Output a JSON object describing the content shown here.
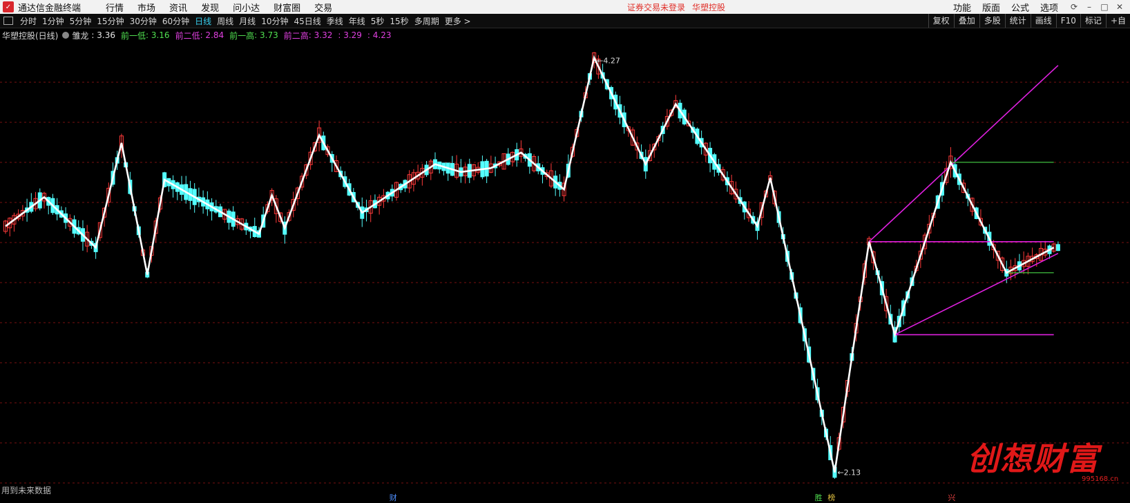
{
  "app": {
    "title": "通达信金融终端",
    "menu": [
      "行情",
      "市场",
      "资讯",
      "发现",
      "问小达",
      "财富圈",
      "交易"
    ],
    "notice": "证券交易未登录",
    "notice_stock": "华塑控股",
    "right_menu": [
      "功能",
      "版面",
      "公式",
      "选项"
    ]
  },
  "toolbar": {
    "periods": [
      "分时",
      "1分钟",
      "5分钟",
      "15分钟",
      "30分钟",
      "60分钟",
      "日线",
      "周线",
      "月线",
      "10分钟",
      "45日线",
      "季线",
      "年线",
      "5秒",
      "15秒",
      "多周期",
      "更多 >"
    ],
    "active_period": "日线",
    "tools": [
      "复权",
      "叠加",
      "多股",
      "统计",
      "画线",
      "F10",
      "标记",
      "+自"
    ]
  },
  "info": {
    "stock": "华塑控股(日线)",
    "indicator": "雏龙",
    "value": ": 3.36",
    "prev_low1_label": "前一低",
    "prev_low1": ": 3.16",
    "prev_low2_label": "前二低",
    "prev_low2": ": 2.84",
    "prev_high1_label": "前一高",
    "prev_high1": ": 3.73",
    "prev_high2_label": "前二高",
    "prev_high2": ": 3.32",
    "extra1": ": 3.29",
    "extra2": ": 4.23"
  },
  "chart_data": {
    "type": "candlestick",
    "title": "",
    "ylim": [
      2.05,
      4.35
    ],
    "annotations": {
      "high": "4.27",
      "low": "2.13"
    },
    "colors": {
      "up": "#ff3a3a",
      "down": "#54ffff",
      "zigzag": "#ffffff",
      "channel": "#e020e0",
      "level": "#40c040",
      "grid": "#7a1010"
    },
    "zigzag": [
      {
        "i": 0,
        "y": 3.4
      },
      {
        "i": 9,
        "y": 3.55
      },
      {
        "i": 21,
        "y": 3.29
      },
      {
        "i": 27,
        "y": 3.83
      },
      {
        "i": 33,
        "y": 3.15
      },
      {
        "i": 37,
        "y": 3.64
      },
      {
        "i": 59,
        "y": 3.36
      },
      {
        "i": 62,
        "y": 3.56
      },
      {
        "i": 65,
        "y": 3.39
      },
      {
        "i": 73,
        "y": 3.87
      },
      {
        "i": 83,
        "y": 3.47
      },
      {
        "i": 100,
        "y": 3.72
      },
      {
        "i": 106,
        "y": 3.68
      },
      {
        "i": 113,
        "y": 3.7
      },
      {
        "i": 120,
        "y": 3.78
      },
      {
        "i": 130,
        "y": 3.59
      },
      {
        "i": 137,
        "y": 4.27
      },
      {
        "i": 149,
        "y": 3.72
      },
      {
        "i": 156,
        "y": 4.03
      },
      {
        "i": 175,
        "y": 3.4
      },
      {
        "i": 178,
        "y": 3.65
      },
      {
        "i": 193,
        "y": 2.13
      },
      {
        "i": 201,
        "y": 3.32
      },
      {
        "i": 207,
        "y": 2.84
      },
      {
        "i": 220,
        "y": 3.73
      },
      {
        "i": 233,
        "y": 3.16
      },
      {
        "i": 244,
        "y": 3.29
      }
    ],
    "channel_lines": [
      {
        "from": {
          "i": 201,
          "y": 3.32
        },
        "to": {
          "i": 245,
          "y": 4.23
        }
      },
      {
        "from": {
          "i": 207,
          "y": 2.84
        },
        "to": {
          "i": 245,
          "y": 3.26
        }
      },
      {
        "from": {
          "i": 201,
          "y": 3.32
        },
        "to": {
          "i": 244,
          "y": 3.32
        }
      },
      {
        "from": {
          "i": 207,
          "y": 2.84
        },
        "to": {
          "i": 244,
          "y": 2.84
        }
      }
    ],
    "level_lines": [
      {
        "from_i": 220,
        "to_i": 244,
        "y": 3.73
      },
      {
        "from_i": 233,
        "to_i": 244,
        "y": 3.16
      }
    ],
    "candle_count": 246
  },
  "footer": {
    "note": "用到未来数据",
    "markers": [
      {
        "text": "财",
        "color": "#5090ff",
        "i": 90
      },
      {
        "text": "胜",
        "color": "#50e050",
        "i": 189
      },
      {
        "text": "榜",
        "color": "#e0c040",
        "i": 192
      },
      {
        "text": "兴",
        "color": "#e04040",
        "i": 220
      }
    ]
  },
  "watermark": {
    "text": "创想财富",
    "url": "995168.cn"
  }
}
